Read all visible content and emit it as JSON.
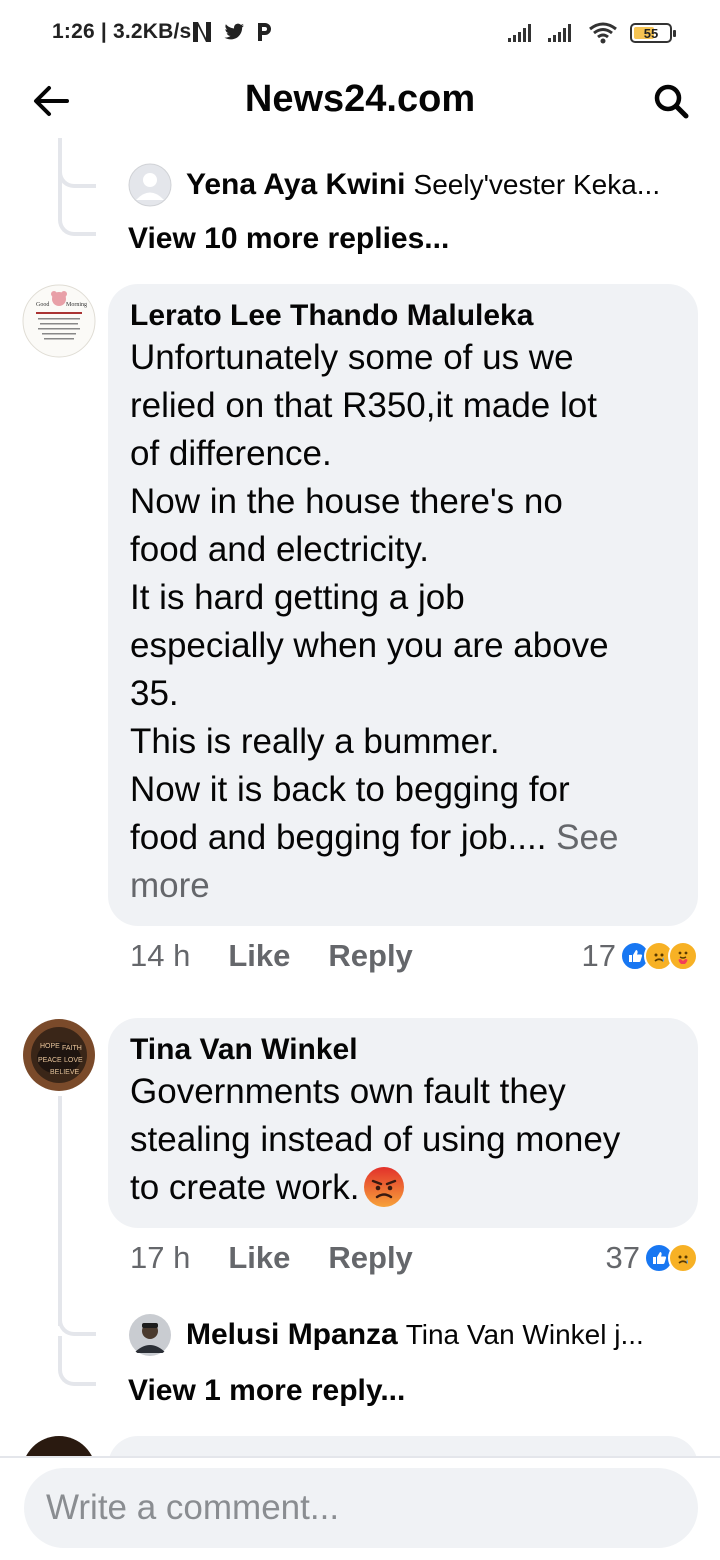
{
  "status_bar": {
    "time": "1:26 | 3.2KB/s",
    "battery": "55",
    "icons": [
      "netflix-icon",
      "twitter-icon",
      "p-icon",
      "signal-icon",
      "signal-icon",
      "wifi-icon",
      "battery-icon"
    ]
  },
  "header": {
    "title": "News24.com",
    "back_icon": "arrow-left-icon",
    "search_icon": "search-icon"
  },
  "comments": [
    {
      "reply_preview": {
        "name": "Yena Aya Kwini",
        "text": "Seely'vester Keka..."
      },
      "view_more": "View 10 more replies..."
    },
    {
      "name": "Lerato Lee Thando Maluleka",
      "lines": [
        "Unfortunately some of us we",
        "relied on that R350,it made lot",
        "of difference.",
        "Now in the house there's no",
        "food and electricity.",
        "It is hard getting a job",
        "especially when you are above",
        "35.",
        "This is really a bummer.",
        "Now it is back to begging for",
        "food and begging for job.... "
      ],
      "see_more_a": "See",
      "see_more_b": "more",
      "time": "14 h",
      "like": "Like",
      "reply": "Reply",
      "reaction_count": "17",
      "reactions": [
        "like",
        "sad",
        "care"
      ]
    },
    {
      "name": "Tina Van Winkel",
      "lines": [
        "Governments own fault they",
        "stealing instead of using money",
        "to create work."
      ],
      "emoji": "angry-face",
      "time": "17 h",
      "like": "Like",
      "reply": "Reply",
      "reaction_count": "37",
      "reactions": [
        "like",
        "sad"
      ],
      "reply_preview": {
        "name": "Melusi Mpanza",
        "text": "Tina Van Winkel j..."
      },
      "view_more": "View 1 more reply..."
    }
  ],
  "composer": {
    "placeholder": "Write a comment..."
  },
  "colors": {
    "bubble": "#f0f2f5",
    "like_blue": "#1877f2",
    "secondary_text": "#65676b",
    "sad_yellow": "#f7b125"
  }
}
